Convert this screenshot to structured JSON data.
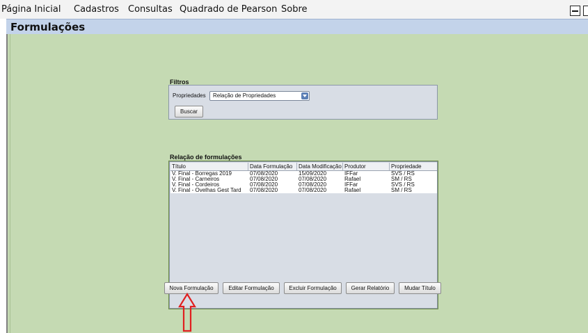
{
  "menu": {
    "items": [
      "Página Inicial",
      "Cadastros",
      "Consultas",
      "Quadrado de Pearson",
      "Sobre"
    ]
  },
  "window": {
    "title": "Formulações"
  },
  "filters": {
    "section_label": "Filtros",
    "property_label": "Propriedades",
    "property_value": "Relação de Propriedades",
    "search_button": "Buscar"
  },
  "table": {
    "section_label": "Relação de formulações",
    "columns": [
      "Título",
      "Data Formulação",
      "Data Modificação",
      "Produtor",
      "Propriedade"
    ],
    "rows": [
      [
        "V. Final - Borregas 2019",
        "07/08/2020",
        "15/09/2020",
        "IFFar",
        "SVS / RS"
      ],
      [
        "V. Final - Carneiros",
        "07/08/2020",
        "07/08/2020",
        "Rafael",
        "SM / RS"
      ],
      [
        "V. Final - Cordeiros",
        "07/08/2020",
        "07/08/2020",
        "IFFar",
        "SVS / RS"
      ],
      [
        "V. Final -  Ovelhas Gest Tard",
        "07/08/2020",
        "07/08/2020",
        "Rafael",
        "SM / RS"
      ]
    ]
  },
  "actions": {
    "new": "Nova Formulação",
    "edit": "Editar Formulação",
    "delete": "Excluir Formulação",
    "report": "Gerar Relatório",
    "rename": "Mudar Título"
  },
  "colors": {
    "background": "#c5dab3",
    "panel": "#d8dde5",
    "annotation": "#e02020"
  },
  "icons": [
    "minimize-icon",
    "maximize-icon",
    "dropdown-arrow-icon",
    "red-arrow-icon"
  ]
}
